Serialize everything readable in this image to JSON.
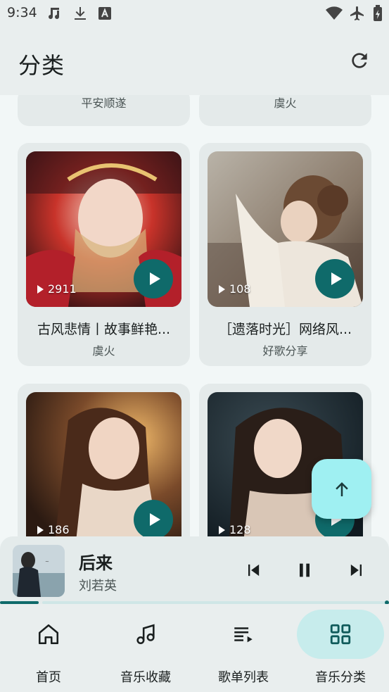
{
  "status_bar": {
    "time": "9:34"
  },
  "app_bar": {
    "title": "分类"
  },
  "top_row": [
    {
      "creator": "平安顺遂"
    },
    {
      "creator": "虞火"
    }
  ],
  "playlists": [
    {
      "count": "2911",
      "name": "古风悲情丨故事鲜艳...",
      "creator": "虞火"
    },
    {
      "count": "108",
      "name": "［遗落时光］网络风...",
      "creator": "好歌分享"
    },
    {
      "count": "186",
      "name": "",
      "creator": ""
    },
    {
      "count": "128",
      "name": "",
      "creator": ""
    }
  ],
  "player": {
    "song": "后来",
    "artist": "刘若英",
    "progress": 0.1
  },
  "nav": [
    {
      "label": "首页",
      "icon": "home-icon",
      "active": false
    },
    {
      "label": "音乐收藏",
      "icon": "music-note-icon",
      "active": false
    },
    {
      "label": "歌单列表",
      "icon": "playlist-icon",
      "active": false
    },
    {
      "label": "音乐分类",
      "icon": "grid-icon",
      "active": true
    }
  ],
  "colors": {
    "accent": "#0f6a6a",
    "fab": "#9ff0f2",
    "active_pill": "#c7ecec"
  }
}
